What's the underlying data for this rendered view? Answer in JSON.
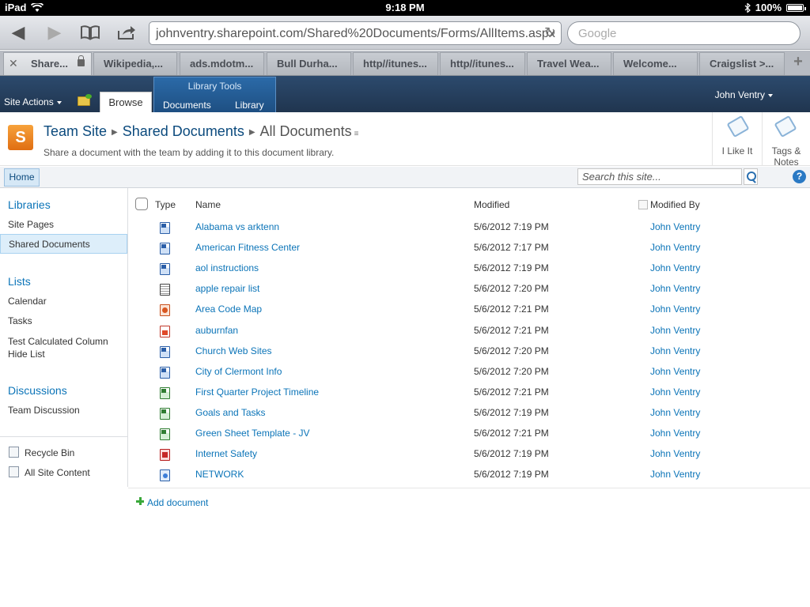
{
  "status_bar": {
    "device": "iPad",
    "time": "9:18 PM",
    "battery": "100%"
  },
  "browser": {
    "url": "johnventry.sharepoint.com/Shared%20Documents/Forms/AllItems.aspx",
    "search_placeholder": "Google",
    "tabs": [
      {
        "label": "Share..."
      },
      {
        "label": "Wikipedia,..."
      },
      {
        "label": "ads.mdotm..."
      },
      {
        "label": "Bull Durha..."
      },
      {
        "label": "http//itunes..."
      },
      {
        "label": "http//itunes..."
      },
      {
        "label": "Travel Wea..."
      },
      {
        "label": "Welcome..."
      },
      {
        "label": "Craigslist >..."
      }
    ]
  },
  "ribbon": {
    "site_actions": "Site Actions",
    "browse": "Browse",
    "library_tools": "Library Tools",
    "documents": "Documents",
    "library": "Library",
    "user": "John Ventry"
  },
  "title_area": {
    "crumb_site": "Team Site",
    "crumb_library": "Shared Documents",
    "crumb_view": "All Documents",
    "description": "Share a document with the team by adding it to this document library.",
    "i_like_it": "I Like It",
    "tags_notes_1": "Tags &",
    "tags_notes_2": "Notes"
  },
  "nav": {
    "home": "Home",
    "search_placeholder": "Search this site..."
  },
  "left_nav": {
    "libraries": "Libraries",
    "site_pages": "Site Pages",
    "shared_documents": "Shared Documents",
    "lists": "Lists",
    "calendar": "Calendar",
    "tasks": "Tasks",
    "test_list_1": "Test Calculated Column",
    "test_list_2": "Hide List",
    "discussions": "Discussions",
    "team_discussion": "Team Discussion",
    "recycle_bin": "Recycle Bin",
    "all_site_content": "All Site Content"
  },
  "list": {
    "columns": {
      "type": "Type",
      "name": "Name",
      "modified": "Modified",
      "modified_by": "Modified By"
    },
    "rows": [
      {
        "name": "Alabama vs arktenn",
        "modified": "5/6/2012 7:19 PM",
        "by": "John Ventry",
        "icon": "word-doc-icon"
      },
      {
        "name": "American Fitness Center",
        "modified": "5/6/2012 7:17 PM",
        "by": "John Ventry",
        "icon": "word-doc-icon"
      },
      {
        "name": "aol instructions",
        "modified": "5/6/2012 7:19 PM",
        "by": "John Ventry",
        "icon": "word-doc-icon"
      },
      {
        "name": "apple repair list",
        "modified": "5/6/2012 7:20 PM",
        "by": "John Ventry",
        "icon": "text-doc-icon"
      },
      {
        "name": "Area Code Map",
        "modified": "5/6/2012 7:21 PM",
        "by": "John Ventry",
        "icon": "powerpoint-icon"
      },
      {
        "name": "auburnfan",
        "modified": "5/6/2012 7:21 PM",
        "by": "John Ventry",
        "icon": "image-file-icon"
      },
      {
        "name": "Church Web Sites",
        "modified": "5/6/2012 7:20 PM",
        "by": "John Ventry",
        "icon": "word-doc-icon"
      },
      {
        "name": "City of Clermont Info",
        "modified": "5/6/2012 7:20 PM",
        "by": "John Ventry",
        "icon": "word-doc-icon"
      },
      {
        "name": "First Quarter Project Timeline",
        "modified": "5/6/2012 7:21 PM",
        "by": "John Ventry",
        "icon": "excel-icon"
      },
      {
        "name": "Goals and Tasks",
        "modified": "5/6/2012 7:19 PM",
        "by": "John Ventry",
        "icon": "excel-icon"
      },
      {
        "name": "Green Sheet Template - JV",
        "modified": "5/6/2012 7:21 PM",
        "by": "John Ventry",
        "icon": "excel-icon"
      },
      {
        "name": "Internet Safety",
        "modified": "5/6/2012 7:19 PM",
        "by": "John Ventry",
        "icon": "pdf-icon"
      },
      {
        "name": "NETWORK",
        "modified": "5/6/2012 7:19 PM",
        "by": "John Ventry",
        "icon": "visio-icon"
      }
    ]
  },
  "add_document": "Add document"
}
